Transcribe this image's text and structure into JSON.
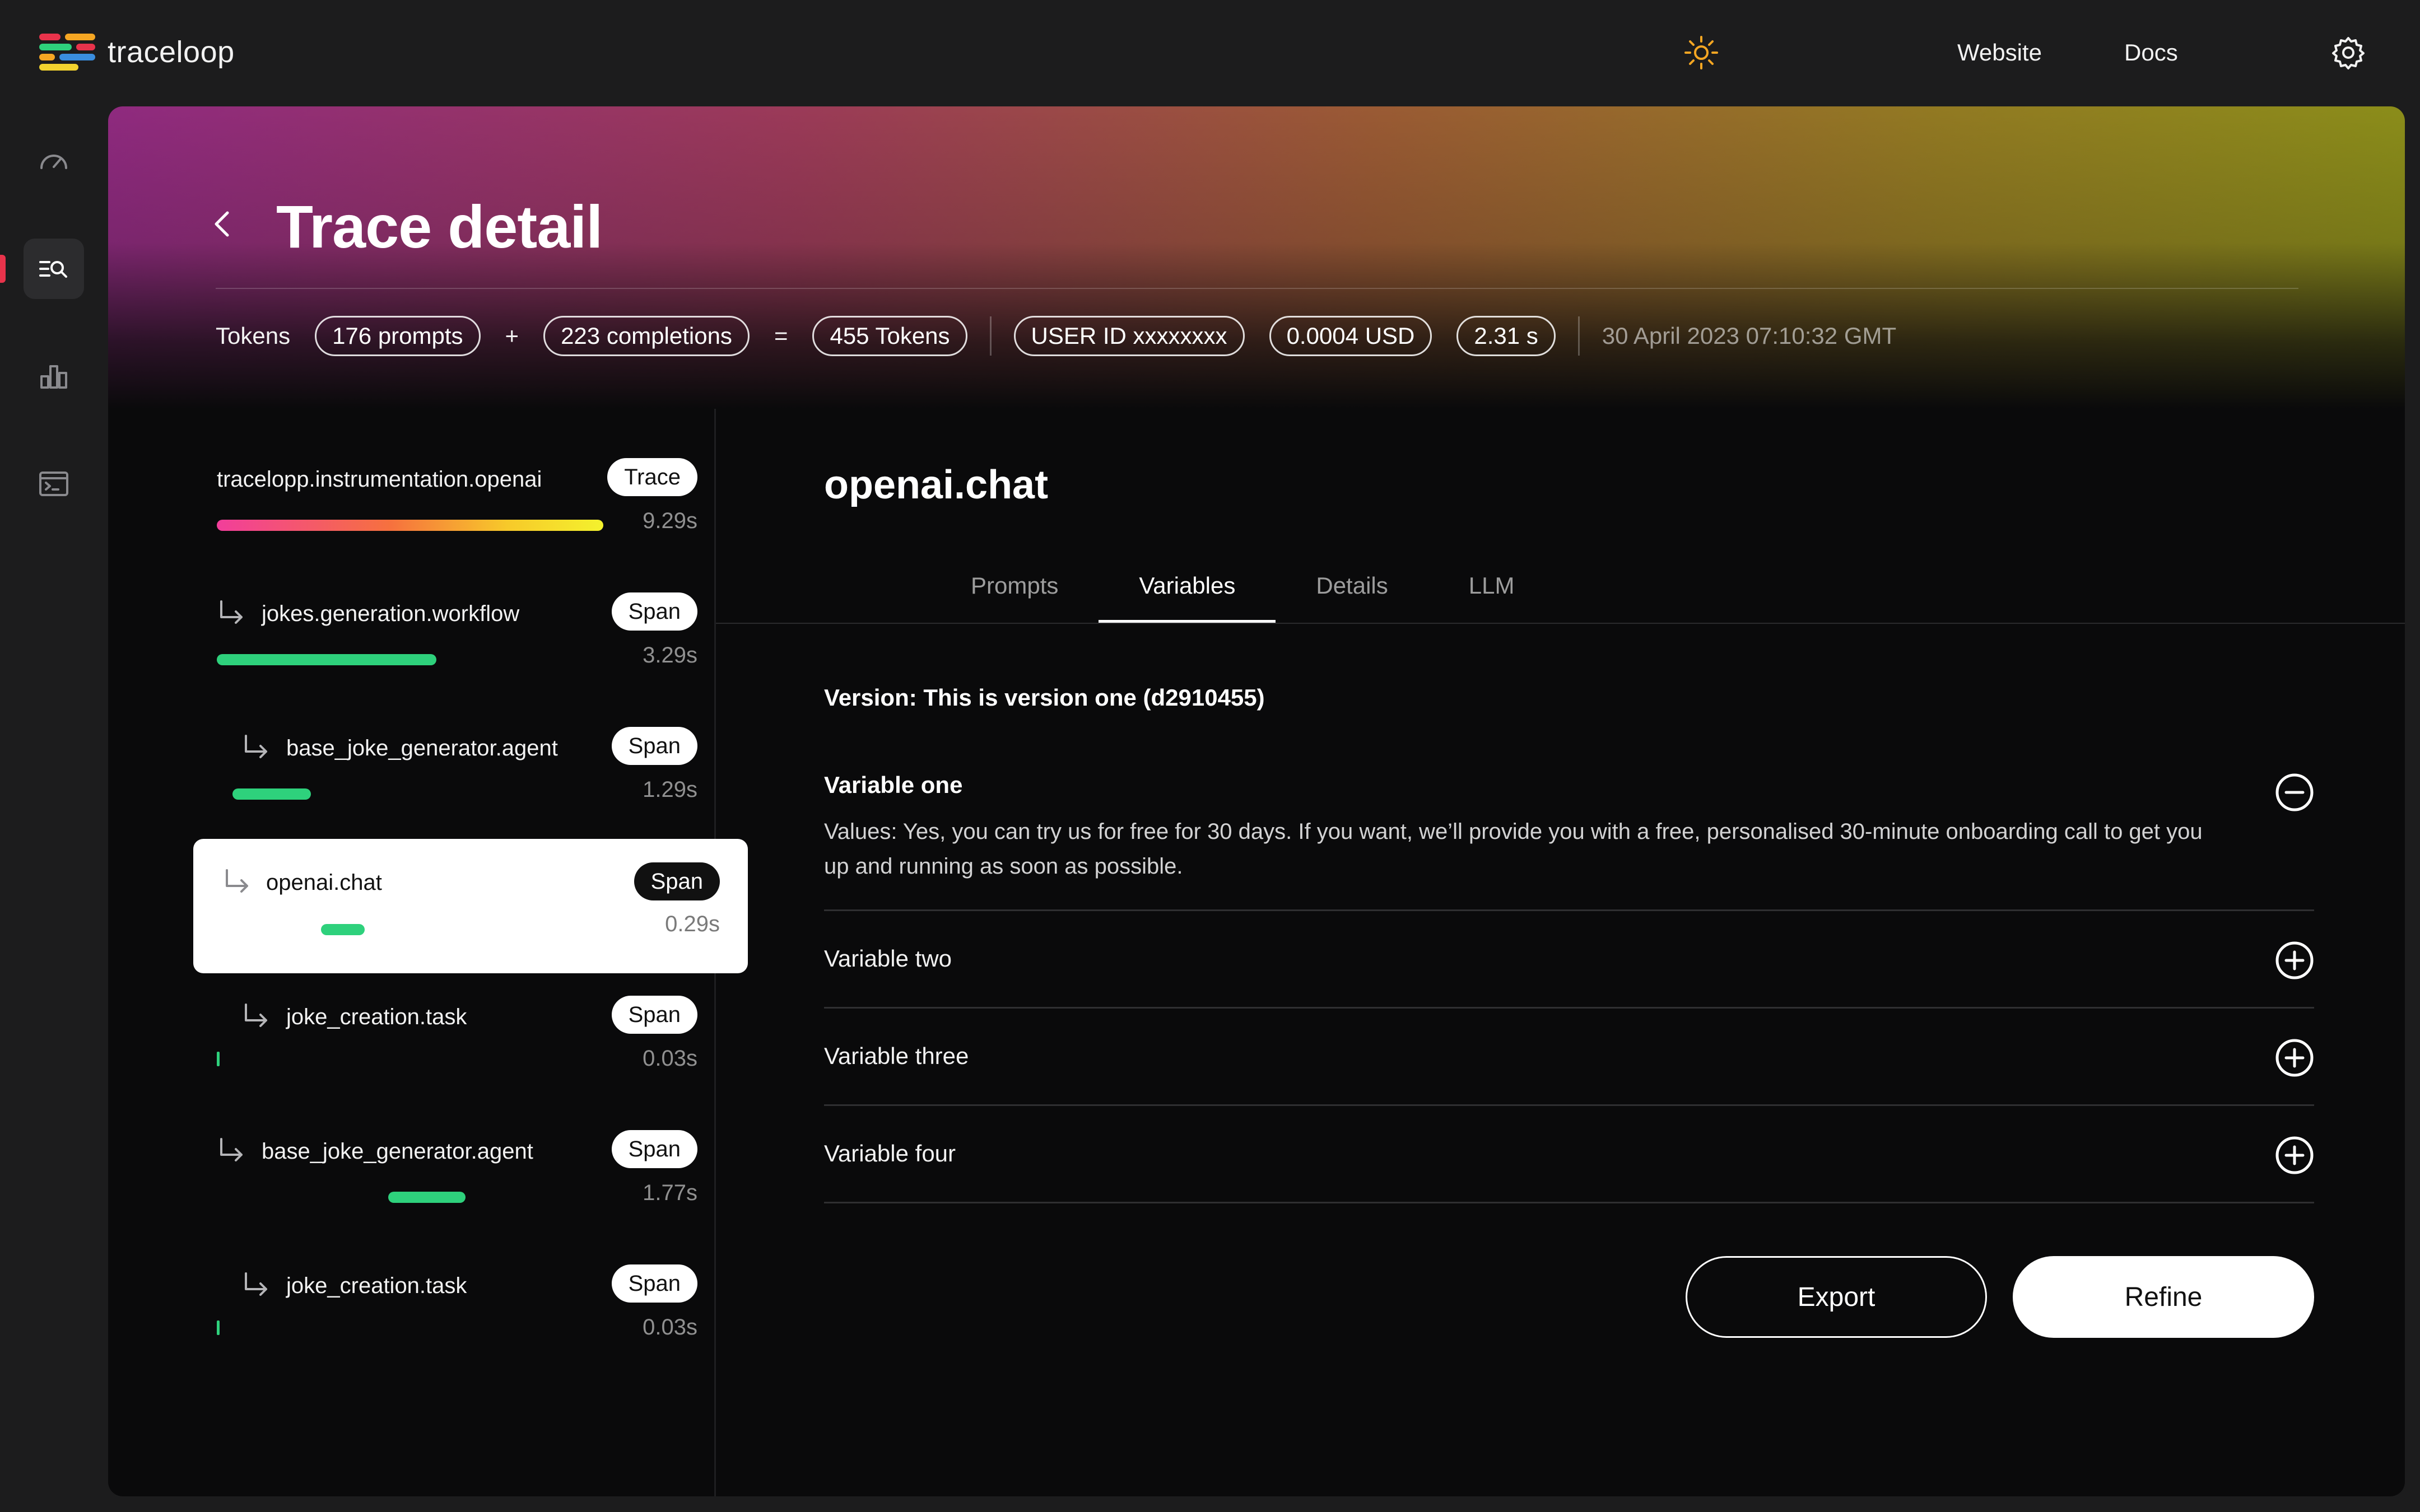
{
  "app": {
    "name": "traceloop",
    "nav": {
      "website": "Website",
      "docs": "Docs"
    },
    "icons": {
      "theme": "sun-icon",
      "settings": "gear-icon"
    },
    "sidebar": [
      {
        "name": "dashboard",
        "icon": "speedometer-icon",
        "active": false
      },
      {
        "name": "traces",
        "icon": "list-search-icon",
        "active": true
      },
      {
        "name": "analytics",
        "icon": "bar-chart-icon",
        "active": false
      },
      {
        "name": "console",
        "icon": "terminal-icon",
        "active": false
      }
    ],
    "colors": {
      "accent": "#e8334b",
      "span_bar": "#2ed17c",
      "sun": "#f5a623"
    }
  },
  "page": {
    "title": "Trace detail",
    "stats": {
      "tokens_label": "Tokens",
      "prompts": "176 prompts",
      "plus": "+",
      "completions": "223 completions",
      "equals": "=",
      "total": "455 Tokens",
      "user_id": "USER ID xxxxxxxx",
      "cost": "0.0004 USD",
      "latency": "2.31 s",
      "timestamp": "30 April 2023 07:10:32 GMT"
    }
  },
  "trace_list": [
    {
      "name": "tracelopp.instrumentation.openai",
      "badge": "Trace",
      "duration": "9.29s",
      "depth": 0,
      "selected": false
    },
    {
      "name": "jokes.generation.workflow",
      "badge": "Span",
      "duration": "3.29s",
      "depth": 1,
      "selected": false
    },
    {
      "name": "base_joke_generator.agent",
      "badge": "Span",
      "duration": "1.29s",
      "depth": 2,
      "selected": false
    },
    {
      "name": "openai.chat",
      "badge": "Span",
      "duration": "0.29s",
      "depth": 1,
      "selected": true
    },
    {
      "name": "joke_creation.task",
      "badge": "Span",
      "duration": "0.03s",
      "depth": 2,
      "selected": false
    },
    {
      "name": "base_joke_generator.agent",
      "badge": "Span",
      "duration": "1.77s",
      "depth": 1,
      "selected": false
    },
    {
      "name": "joke_creation.task",
      "badge": "Span",
      "duration": "0.03s",
      "depth": 2,
      "selected": false
    }
  ],
  "detail": {
    "title": "openai.chat",
    "tabs": [
      {
        "label": "Prompts",
        "active": false
      },
      {
        "label": "Variables",
        "active": true
      },
      {
        "label": "Details",
        "active": false
      },
      {
        "label": "LLM",
        "active": false
      }
    ],
    "version": "Version: This is version one (d2910455)",
    "variables": [
      {
        "title": "Variable one",
        "expanded": true,
        "values": "Values: Yes, you can try us for free for 30 days. If you want, we’ll provide you with a free, personalised 30-minute onboarding call to get you up and running as soon as possible."
      },
      {
        "title": "Variable two",
        "expanded": false
      },
      {
        "title": "Variable three",
        "expanded": false
      },
      {
        "title": "Variable four",
        "expanded": false
      }
    ],
    "actions": {
      "export": "Export",
      "refine": "Refine"
    }
  }
}
